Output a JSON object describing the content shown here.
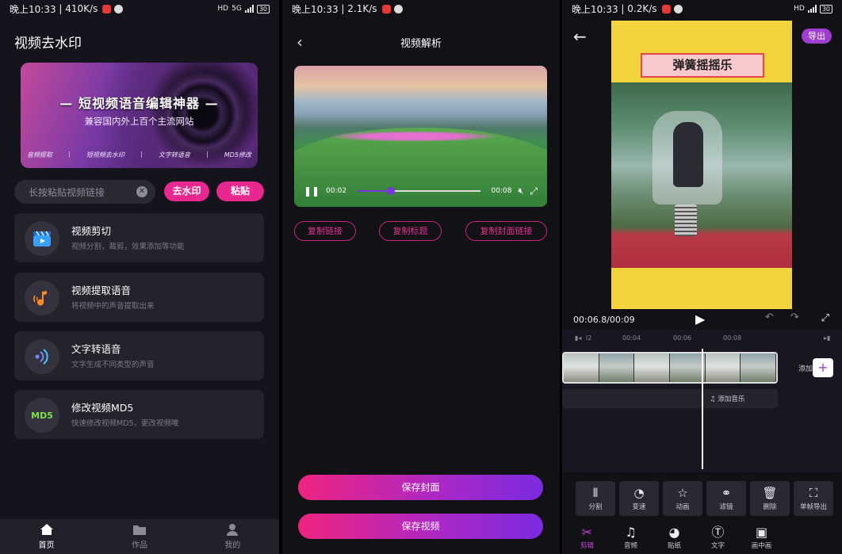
{
  "panel1": {
    "status": {
      "time": "晚上10:33",
      "speed": "410K/s",
      "net": "5G",
      "battery": "30"
    },
    "title": "视频去水印",
    "banner": {
      "headline": "— 短视频语音编辑神器 —",
      "subline": "兼容国内外上百个主流网站",
      "features": [
        "音频提取",
        "短视频去水印",
        "文字转语音",
        "MD5修改"
      ]
    },
    "search": {
      "placeholder": "长按粘贴视频链接"
    },
    "buttons": {
      "remove_watermark": "去水印",
      "paste": "粘贴"
    },
    "menu": [
      {
        "title": "视频剪切",
        "desc": "视频分割，裁剪，效果添加等功能",
        "icon": "clapperboard-icon"
      },
      {
        "title": "视频提取语音",
        "desc": "将视频中的声音提取出来",
        "icon": "music-note-icon"
      },
      {
        "title": "文字转语音",
        "desc": "文字生成不同类型的声音",
        "icon": "sound-wave-icon"
      },
      {
        "title": "修改视频MD5",
        "desc": "快速修改视频MD5，更改视频唯",
        "icon_text": "MD5"
      }
    ],
    "tabs": [
      {
        "label": "首页",
        "icon": "home-icon"
      },
      {
        "label": "作品",
        "icon": "folder-icon"
      },
      {
        "label": "我的",
        "icon": "user-icon"
      }
    ]
  },
  "panel2": {
    "status": {
      "time": "晚上10:33",
      "speed": "2.1K/s"
    },
    "title": "视频解析",
    "video": {
      "current": "00:02",
      "total": "00:08",
      "progress": 0.27
    },
    "actions": [
      "复制链接",
      "复制标题",
      "复制封面链接"
    ],
    "save_cover": "保存封面",
    "save_video": "保存视频"
  },
  "panel3": {
    "status": {
      "time": "晚上10:33",
      "speed": "0.2K/s",
      "battery": "30"
    },
    "export": "导出",
    "video_title": "弹簧摇摇乐",
    "time": "00:06.8/00:09",
    "ruler": [
      "00:04",
      "00:06",
      "00:08"
    ],
    "ruler_start": "l2",
    "add_clip": "添加",
    "add_music": "添加音乐",
    "tools": [
      {
        "label": "分割",
        "icon": "split-icon"
      },
      {
        "label": "变速",
        "icon": "speed-icon"
      },
      {
        "label": "动画",
        "icon": "star-icon"
      },
      {
        "label": "滤镜",
        "icon": "filter-icon"
      },
      {
        "label": "删除",
        "icon": "trash-icon"
      },
      {
        "label": "单帧导出",
        "icon": "frame-export-icon"
      }
    ],
    "nav": [
      {
        "label": "剪辑",
        "icon": "scissors-icon"
      },
      {
        "label": "音频",
        "icon": "music-icon"
      },
      {
        "label": "贴纸",
        "icon": "sticker-icon"
      },
      {
        "label": "文字",
        "icon": "text-icon"
      },
      {
        "label": "画中画",
        "icon": "pip-icon"
      }
    ]
  },
  "colors": {
    "accent_pink": "#e8288e",
    "accent_purple": "#a03ed0",
    "bg_dark": "#15141c"
  }
}
